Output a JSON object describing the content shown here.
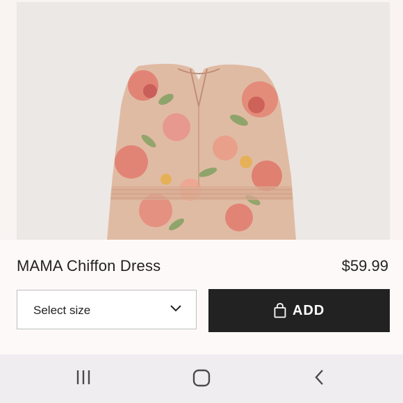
{
  "product": {
    "title": "MAMA Chiffon Dress",
    "price": "$59.99",
    "image_alt": "MAMA Chiffon Dress floral product photo"
  },
  "size_select": {
    "placeholder": "Select size",
    "icon": "chevron-down-icon"
  },
  "add_button": {
    "label": "ADD",
    "icon": "shopping-bag-icon"
  },
  "system_nav": {
    "recents_icon": "recent-apps-icon",
    "home_icon": "home-icon",
    "back_icon": "back-icon"
  },
  "colors": {
    "background": "#fdf9f8",
    "button_dark": "#222222",
    "text": "#222222",
    "nav_bar": "#efedf0",
    "dress_base": "#dfb8a0",
    "flower_pink": "#e07a6e"
  }
}
